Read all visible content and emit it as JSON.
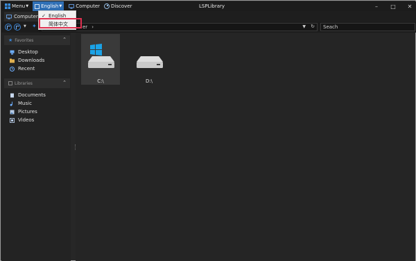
{
  "titlebar": {
    "menu_label": "Menu",
    "language_label": "English",
    "computer_label": "Computer",
    "discover_label": "Discover",
    "title": "LSPLibrary",
    "minimize": "–",
    "maximize": "□",
    "close": "✕"
  },
  "tabs": [
    {
      "label": "Computer"
    }
  ],
  "navbar": {
    "address_text": "er",
    "address_chevron": "›",
    "search_placeholder": "Seach"
  },
  "language_menu": {
    "options": [
      {
        "label": "English",
        "checked": true
      },
      {
        "label": "简体中文",
        "checked": false
      }
    ]
  },
  "sidebar": {
    "favorites_header": "Favorites",
    "favorites": [
      {
        "label": "Desktop",
        "icon": "desktop-icon"
      },
      {
        "label": "Downloads",
        "icon": "folder-icon"
      },
      {
        "label": "Recent",
        "icon": "clock-icon"
      }
    ],
    "libraries_header": "Libraries",
    "libraries": [
      {
        "label": "Documents",
        "icon": "documents-icon"
      },
      {
        "label": "Music",
        "icon": "music-icon"
      },
      {
        "label": "Pictures",
        "icon": "pictures-icon"
      },
      {
        "label": "Videos",
        "icon": "videos-icon"
      }
    ]
  },
  "drives": [
    {
      "label": "C:\\",
      "selected": true,
      "system": true
    },
    {
      "label": "D:\\",
      "selected": false,
      "system": false
    }
  ],
  "colors": {
    "accent": "#2f6fb5",
    "highlight_box": "#e03050",
    "windows_logo": "#1aa3e8"
  }
}
